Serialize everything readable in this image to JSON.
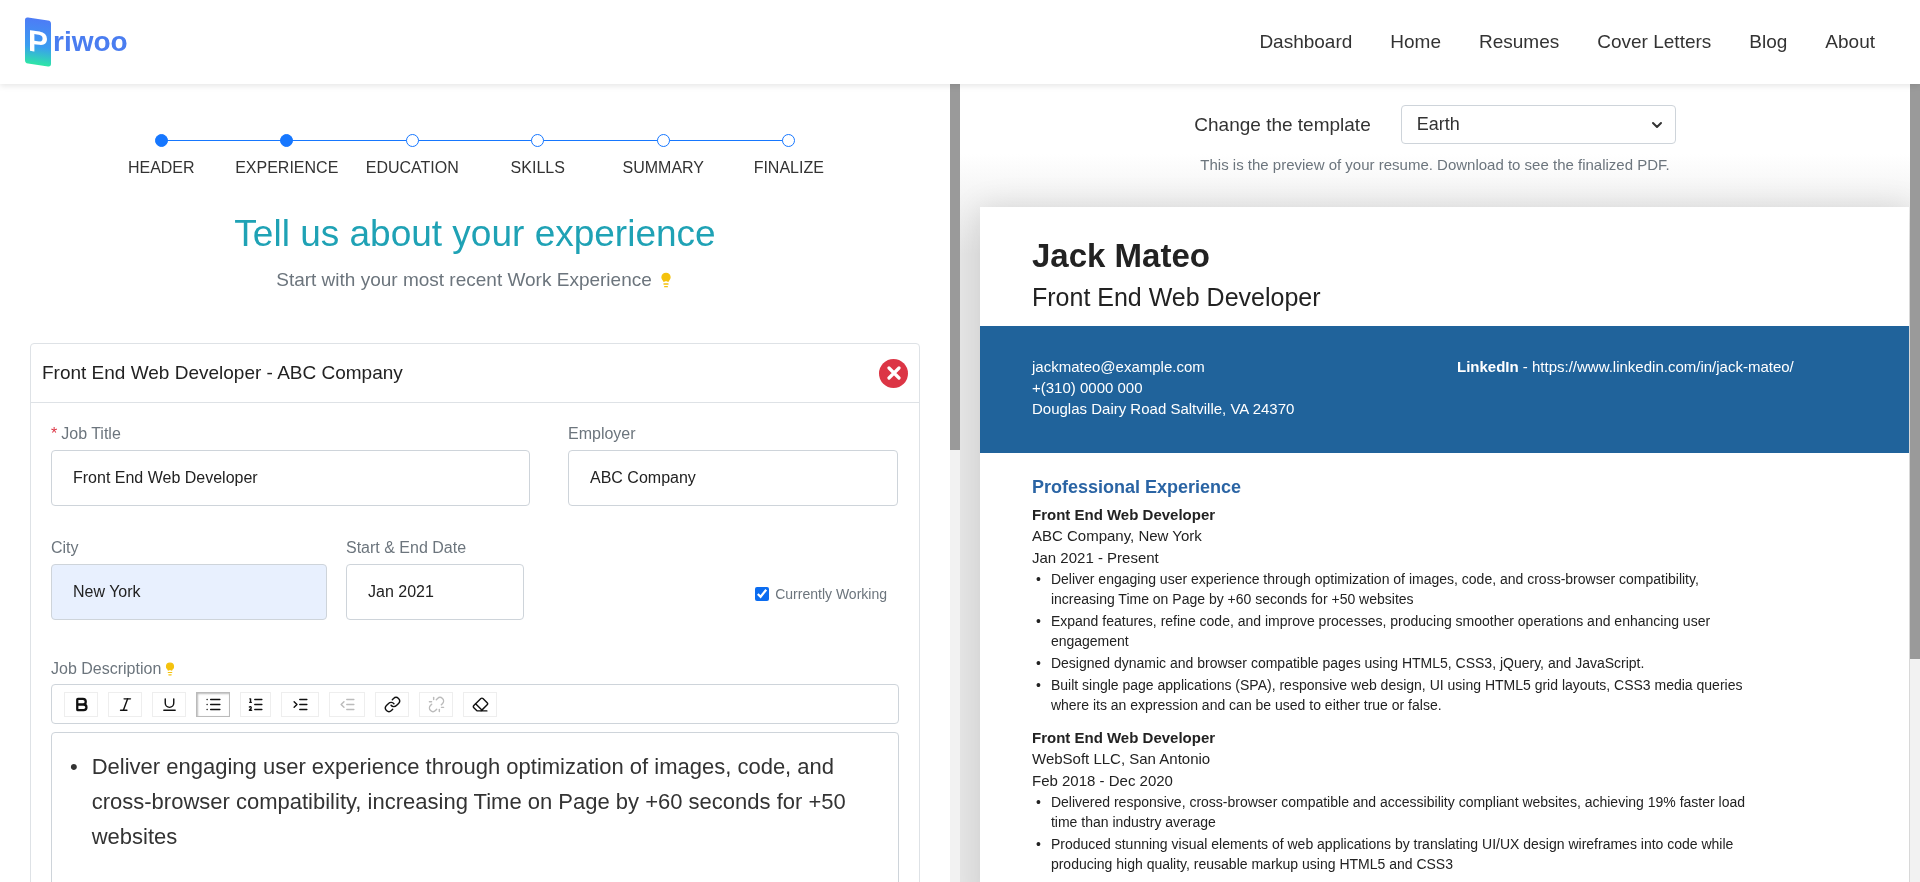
{
  "logo": {
    "mark": "P",
    "text": "riwoo"
  },
  "nav": [
    {
      "label": "Dashboard"
    },
    {
      "label": "Home"
    },
    {
      "label": "Resumes"
    },
    {
      "label": "Cover Letters"
    },
    {
      "label": "Blog"
    },
    {
      "label": "About"
    }
  ],
  "stepper": [
    {
      "label": "HEADER",
      "completed": true
    },
    {
      "label": "EXPERIENCE",
      "completed": true
    },
    {
      "label": "EDUCATION",
      "completed": false
    },
    {
      "label": "SKILLS",
      "completed": false
    },
    {
      "label": "SUMMARY",
      "completed": false
    },
    {
      "label": "FINALIZE",
      "completed": false
    }
  ],
  "heading": "Tell us about your experience",
  "subheading": "Start with your most recent Work Experience",
  "experience_card": {
    "title": "Front End Web Developer - ABC Company",
    "fields": [
      {
        "label": "Job Title",
        "required_mark": "*",
        "value": "Front End Web Developer",
        "autofilled": false
      },
      {
        "label": "Employer",
        "value": "ABC Company",
        "autofilled": false
      },
      {
        "label": "City",
        "value": "New York",
        "autofilled": true
      },
      {
        "label": "Start & End Date",
        "value": "Jan 2021",
        "autofilled": false
      }
    ],
    "currently_working": {
      "label": "Currently Working",
      "checked": true
    },
    "description_label": "Job Description",
    "toolbar": [
      {
        "kind": "bold",
        "active": false,
        "disabled": false
      },
      {
        "kind": "italic",
        "active": false,
        "disabled": false
      },
      {
        "kind": "underline",
        "active": false,
        "disabled": false
      },
      {
        "kind": "bullets",
        "active": true,
        "disabled": false
      },
      {
        "kind": "numbers",
        "active": false,
        "disabled": false
      },
      {
        "kind": "indent",
        "active": false,
        "disabled": false
      },
      {
        "kind": "outdent",
        "active": false,
        "disabled": true
      },
      {
        "kind": "link",
        "active": false,
        "disabled": false
      },
      {
        "kind": "unlink",
        "active": false,
        "disabled": true
      },
      {
        "kind": "clear",
        "active": false,
        "disabled": false
      }
    ],
    "description_items": [
      {
        "marker": "•",
        "text": "Deliver engaging user experience through optimization of images, code, and cross-browser compatibility, increasing Time on Page by +60 seconds for +50 websites"
      }
    ]
  },
  "template_picker": {
    "label": "Change the template",
    "value": "Earth",
    "note": "This is the preview of your resume. Download to see the finalized PDF."
  },
  "resume": {
    "name": "Jack Mateo",
    "title": "Front End Web Developer",
    "contact": [
      "jackmateo@example.com",
      "+(310) 0000 000",
      "Douglas Dairy Road Saltville, VA 24370"
    ],
    "linkedin": "**LinkedIn** - https://www.linkedin.com/in/jack-mateo/",
    "section_title": "Professional Experience",
    "jobs": [
      {
        "role": "Front End Web Developer",
        "company": "ABC Company, New York",
        "dates": "Jan 2021 - Present",
        "bullets": [
          {
            "marker": "•",
            "text": "Deliver engaging user experience through optimization of images, code, and cross-browser compatibility, increasing Time on Page by +60 seconds for +50 websites"
          },
          {
            "marker": "•",
            "text": "Expand features, refine code, and improve processes, producing smoother operations and enhancing user engagement"
          },
          {
            "marker": "•",
            "text": "Designed dynamic and browser compatible pages using HTML5, CSS3, jQuery, and JavaScript."
          },
          {
            "marker": "•",
            "text": "Built single page applications (SPA), responsive web design, UI using HTML5 grid layouts, CSS3 media queries where its an expression and can be used to either true or false."
          }
        ]
      },
      {
        "role": "Front End Web Developer",
        "company": "WebSoft LLC, San Antonio",
        "dates": "Feb 2018 - Dec 2020",
        "bullets": [
          {
            "marker": "•",
            "text": "Delivered responsive, cross-browser compatible and accessibility compliant websites, achieving 19% faster load time than industry average"
          },
          {
            "marker": "•",
            "text": "Produced stunning visual elements of web applications by translating UI/UX design wireframes into code while producing high quality, reusable markup using HTML5 and CSS3"
          }
        ]
      }
    ]
  }
}
